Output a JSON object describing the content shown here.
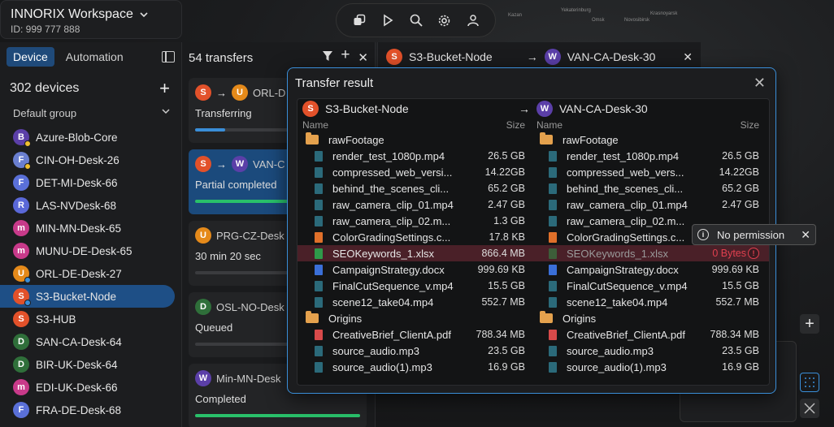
{
  "workspace": {
    "title": "INNORIX Workspace",
    "id": "ID: 999 777 888"
  },
  "map_labels": [
    "Yekaterinburg",
    "Novosibirsk",
    "Krasnoyarsk",
    "Omsk",
    "Kazan"
  ],
  "tabs": [
    {
      "label": "Device",
      "active": true
    },
    {
      "label": "Automation",
      "active": false
    }
  ],
  "devices": {
    "count": "302  devices",
    "group": "Default group",
    "items": [
      {
        "letter": "B",
        "color": "#5b3fa8",
        "name": "Azure-Blob-Core",
        "status": "#f0c030"
      },
      {
        "letter": "F",
        "color": "#6a7fd0",
        "name": "CIN-OH-Desk-26",
        "status": "#f0c030"
      },
      {
        "letter": "F",
        "color": "#5a70d8",
        "name": "DET-MI-Desk-66",
        "status": ""
      },
      {
        "letter": "R",
        "color": "#5a68d8",
        "name": "LAS-NVDesk-68",
        "status": ""
      },
      {
        "letter": "m",
        "color": "#c83a8a",
        "name": "MIN-MN-Desk-65",
        "status": ""
      },
      {
        "letter": "m",
        "color": "#c83a8a",
        "name": "MUNU-DE-Desk-65",
        "status": ""
      },
      {
        "letter": "U",
        "color": "#e58a1a",
        "name": "ORL-DE-Desk-27",
        "status": "#3a8ed8"
      },
      {
        "letter": "S",
        "color": "#e2512a",
        "name": "S3-Bucket-Node",
        "status": "#3a8ed8",
        "selected": true
      },
      {
        "letter": "S",
        "color": "#e2512a",
        "name": "S3-HUB",
        "status": ""
      },
      {
        "letter": "D",
        "color": "#2f6f3a",
        "name": "SAN-CA-Desk-64",
        "status": ""
      },
      {
        "letter": "D",
        "color": "#2f6f3a",
        "name": "BIR-UK-Desk-64",
        "status": ""
      },
      {
        "letter": "m",
        "color": "#c83a8a",
        "name": "EDI-UK-Desk-66",
        "status": ""
      },
      {
        "letter": "F",
        "color": "#5a70d8",
        "name": "FRA-DE-Desk-68",
        "status": ""
      }
    ]
  },
  "transfers": {
    "count": "54  transfers",
    "cards": [
      {
        "src": "S",
        "src_color": "#e2512a",
        "dst": "U",
        "dst_color": "#e58a1a",
        "name": "ORL-D",
        "status": "Transferring",
        "progress": 0.18,
        "bar_color": "#3a8ed8"
      },
      {
        "src": "S",
        "src_color": "#e2512a",
        "dst": "W",
        "dst_color": "#5b3fa8",
        "name": "VAN-C",
        "status": "Partial completed",
        "progress": 0.9,
        "bar_color": "#29c06a",
        "selected": true
      },
      {
        "src": "",
        "dst": "U",
        "dst_color": "#e58a1a",
        "name": "PRG-CZ-Desk",
        "status": "30 min 20 sec",
        "progress": 0,
        "bar_color": "#3a8ed8"
      },
      {
        "src": "",
        "dst": "D",
        "dst_color": "#2f6f3a",
        "name": "OSL-NO-Desk",
        "status": "Queued",
        "progress": 0,
        "bar_color": "#3a8ed8"
      },
      {
        "src": "",
        "dst": "W",
        "dst_color": "#5b3fa8",
        "name": "Min-MN-Desk",
        "status": "Completed",
        "progress": 1,
        "bar_color": "#29c06a"
      }
    ]
  },
  "right_panel": {
    "src": "S3-Bucket-Node",
    "dst": "VAN-CA-Desk-30"
  },
  "dialog": {
    "title": "Transfer result",
    "left_node": "S3-Bucket-Node",
    "right_node": "VAN-CA-Desk-30",
    "col_name": "Name",
    "col_size": "Size",
    "rows": [
      {
        "type": "folder",
        "name": "rawFootage",
        "size": "",
        "r_name": "rawFootage",
        "r_size": ""
      },
      {
        "type": "video",
        "name": "render_test_1080p.mp4",
        "size": "26.5 GB",
        "r_name": "render_test_1080p.mp4",
        "r_size": "26.5 GB"
      },
      {
        "type": "video",
        "name": "compressed_web_versi...",
        "size": "14.22GB",
        "r_name": "compressed_web_vers...",
        "r_size": "14.22GB"
      },
      {
        "type": "video",
        "name": "behind_the_scenes_cli...",
        "size": "65.2 GB",
        "r_name": "behind_the_scenes_cli...",
        "r_size": "65.2 GB"
      },
      {
        "type": "video",
        "name": "raw_camera_clip_01.mp4",
        "size": "2.47 GB",
        "r_name": "raw_camera_clip_01.mp4",
        "r_size": "2.47 GB"
      },
      {
        "type": "video",
        "name": "raw_camera_clip_02.m...",
        "size": "1.3 GB",
        "r_name": "raw_camera_clip_02.m...",
        "r_size": ""
      },
      {
        "type": "settings",
        "name": "ColorGradingSettings.c...",
        "size": "17.8 KB",
        "r_name": "ColorGradingSettings.c...",
        "r_size": ""
      },
      {
        "type": "sheet",
        "name": "SEOKeywords_1.xlsx",
        "size": "866.4 MB",
        "r_name": "SEOKeywords_1.xlsx",
        "r_size": "0 Bytes",
        "error": true
      },
      {
        "type": "doc",
        "name": "CampaignStrategy.docx",
        "size": "999.69 KB",
        "r_name": "CampaignStrategy.docx",
        "r_size": "999.69 KB"
      },
      {
        "type": "video",
        "name": "FinalCutSequence_v.mp4",
        "size": "15.5 GB",
        "r_name": "FinalCutSequence_v.mp4",
        "r_size": "15.5 GB"
      },
      {
        "type": "video",
        "name": "scene12_take04.mp4",
        "size": "552.7 MB",
        "r_name": "scene12_take04.mp4",
        "r_size": "552.7 MB"
      },
      {
        "type": "folder",
        "name": "Origins",
        "size": "",
        "r_name": "Origins",
        "r_size": ""
      },
      {
        "type": "pdf",
        "name": "CreativeBrief_ClientA.pdf",
        "size": "788.34 MB",
        "r_name": "CreativeBrief_ClientA.pdf",
        "r_size": "788.34 MB"
      },
      {
        "type": "audio",
        "name": "source_audio.mp3",
        "size": "23.5 GB",
        "r_name": "source_audio.mp3",
        "r_size": "23.5 GB"
      },
      {
        "type": "audio",
        "name": "source_audio(1).mp3",
        "size": "16.9 GB",
        "r_name": "source_audio(1).mp3",
        "r_size": "16.9 GB"
      }
    ]
  },
  "tooltip": {
    "text": "No permission"
  },
  "colors": {
    "accent": "#3a8ed8",
    "error": "#e0404f",
    "folder": "#e4a14d"
  }
}
